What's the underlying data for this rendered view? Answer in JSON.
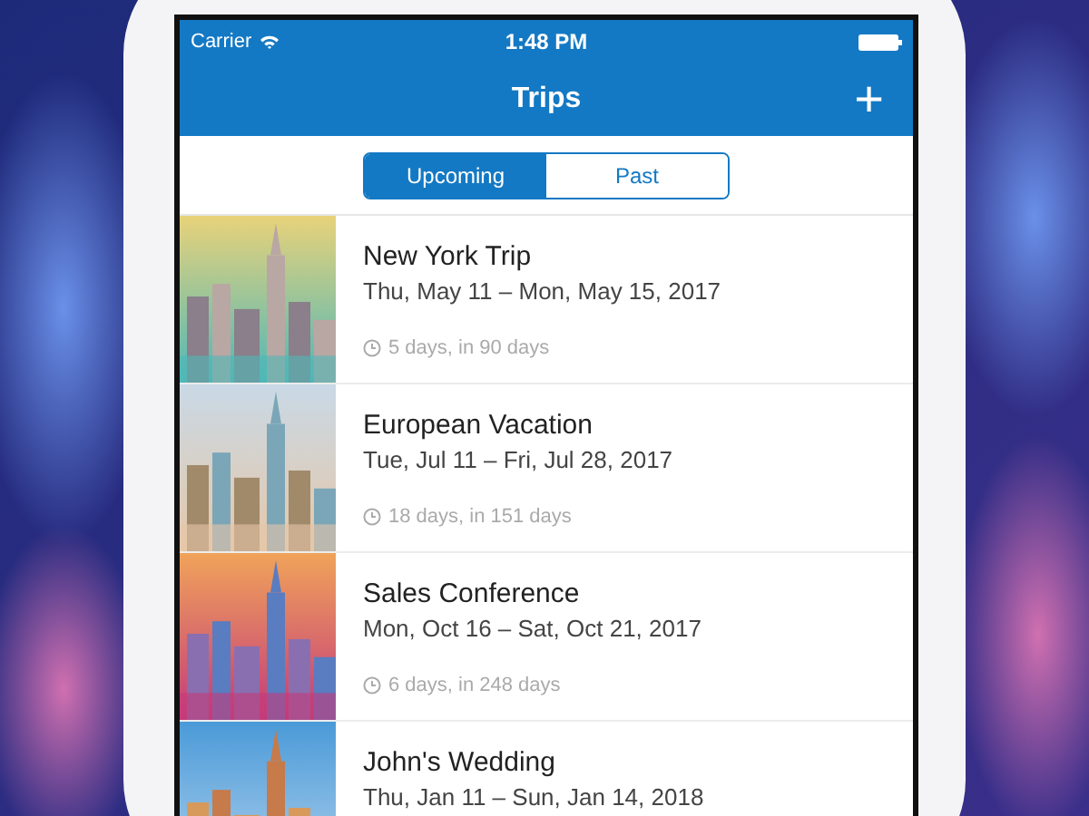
{
  "status_bar": {
    "carrier": "Carrier",
    "time": "1:48 PM"
  },
  "nav_bar": {
    "title": "Trips",
    "add_button": "+"
  },
  "tabs": [
    {
      "label": "Upcoming",
      "selected": true
    },
    {
      "label": "Past",
      "selected": false
    }
  ],
  "trips": [
    {
      "title": "New York Trip",
      "dates": "Thu, May 11 – Mon, May 15, 2017",
      "duration": "5 days, in 90 days"
    },
    {
      "title": "European Vacation",
      "dates": "Tue, Jul 11 – Fri, Jul 28, 2017",
      "duration": "18 days, in 151 days"
    },
    {
      "title": "Sales Conference",
      "dates": "Mon, Oct 16 – Sat, Oct 21, 2017",
      "duration": "6 days, in 248 days"
    },
    {
      "title": "John's Wedding",
      "dates": "Thu, Jan 11 – Sun, Jan 14, 2018"
    }
  ]
}
